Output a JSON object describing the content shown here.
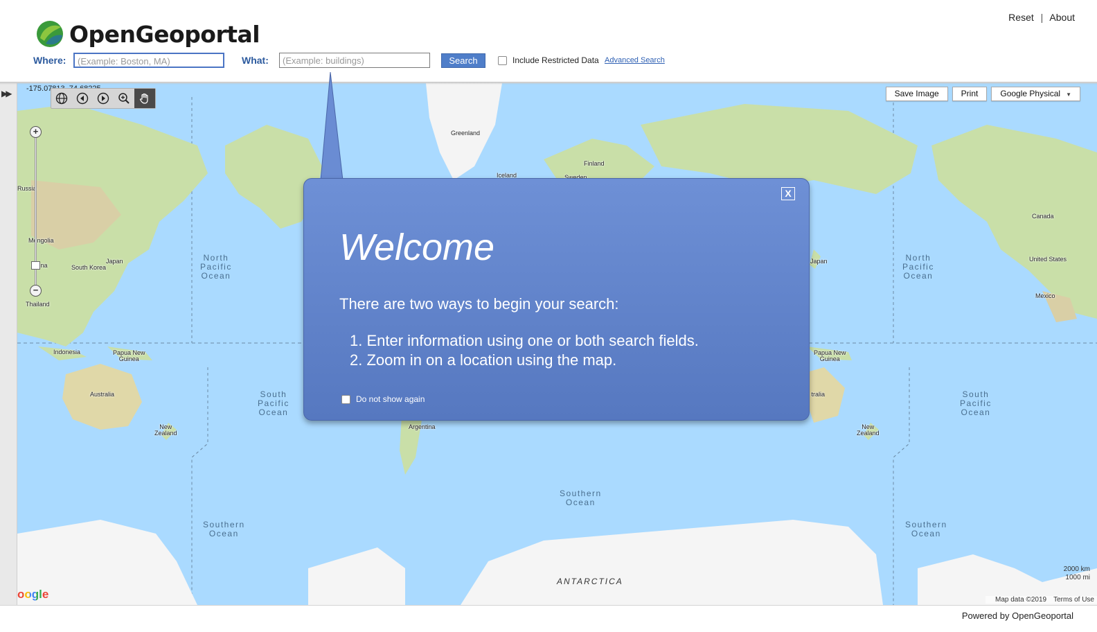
{
  "header": {
    "app_name": "OpenGeoportal",
    "logo_icon": "globe-leaf-icon",
    "links": {
      "reset": "Reset",
      "separator": "|",
      "about": "About"
    }
  },
  "search": {
    "where_label": "Where:",
    "where_placeholder": "(Example: Boston, MA)",
    "what_label": "What:",
    "what_placeholder": "(Example: buildings)",
    "search_button": "Search",
    "include_restricted_label": "Include Restricted Data",
    "include_restricted_checked": false,
    "advanced_search_link": "Advanced Search"
  },
  "map": {
    "coordinate_readout": "-175.07813, 74.68225",
    "tools": [
      "globe-icon",
      "back-arrow-icon",
      "forward-arrow-icon",
      "zoom-box-icon",
      "pan-hand-icon"
    ],
    "active_tool": "pan-hand-icon",
    "zoom_in": "+",
    "zoom_out": "−",
    "buttons": {
      "save_image": "Save Image",
      "print": "Print",
      "basemap": "Google Physical"
    },
    "labels": {
      "greenland": "Greenland",
      "iceland": "Iceland",
      "finland": "Finland",
      "sweden": "Sweden",
      "russia": "Russia",
      "mongolia": "Mongolia",
      "china": "China",
      "south_korea": "South Korea",
      "japan": "Japan",
      "japan2": "Japan",
      "thailand": "Thailand",
      "indonesia": "Indonesia",
      "papua": "Papua New\nGuinea",
      "papua2": "Papua New\nGuinea",
      "australia": "Australia",
      "australia2": "Australia",
      "nz": "New\nZealand",
      "nz2": "New\nZealand",
      "argentina": "Argentina",
      "canada": "Canada",
      "usa": "United States",
      "mexico": "Mexico",
      "north_pacific": "North\nPacific\nOcean",
      "north_pacific2": "North\nPacific\nOcean",
      "south_pacific": "South\nPacific\nOcean",
      "south_pacific2": "South\nPacific\nOcean",
      "southern1": "Southern\nOcean",
      "southern2": "Southern\nOcean",
      "southern3": "Southern\nOcean",
      "antarctica": "ANTARCTICA"
    },
    "google_logo": "oogle",
    "scale": {
      "km": "2000 km",
      "mi": "1000 mi"
    },
    "attribution": {
      "map_data": "Map data ©2019",
      "terms": "Terms of Use"
    }
  },
  "welcome": {
    "title": "Welcome",
    "intro": "There are two ways to begin your search:",
    "items": [
      "1. Enter information using one or both search fields.",
      "2. Zoom in on a location using the map."
    ],
    "dont_show_label": "Do not show again",
    "dont_show_checked": false,
    "close_label": "X"
  },
  "footer": {
    "powered_by": "Powered by OpenGeoportal"
  },
  "colors": {
    "accent": "#4f7ec9",
    "label_blue": "#2c5a9e",
    "ocean": "#aadaff",
    "dialog": "#6586cd"
  }
}
